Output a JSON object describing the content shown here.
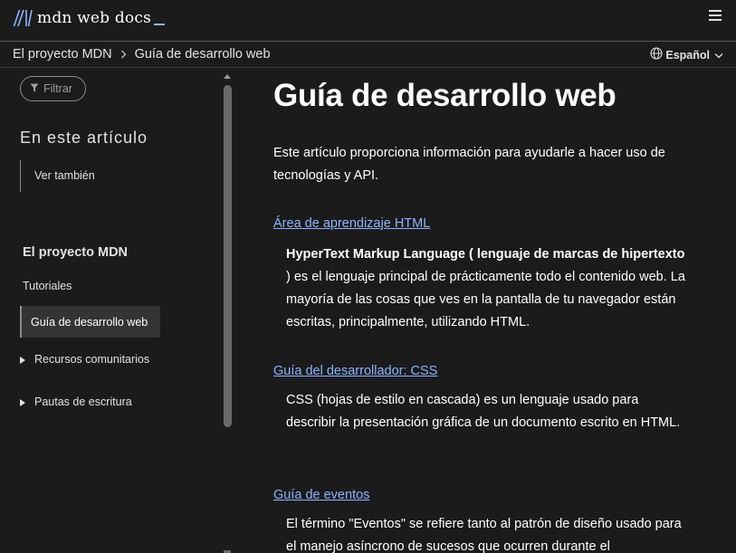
{
  "header": {
    "logo_text": "mdn web docs",
    "logo_icon": "mdn-m-icon",
    "menu_icon": "hamburger-menu-icon"
  },
  "breadcrumb": {
    "items": [
      "El proyecto MDN",
      "Guía de desarrollo web"
    ],
    "separator_icon": "chevron-right-icon"
  },
  "language": {
    "label": "Español",
    "icon": "globe-icon",
    "chevron": "chevron-down-icon"
  },
  "sidebar": {
    "filter_placeholder": "Filtrar",
    "filter_icon": "filter-icon",
    "toc_title": "En este artículo",
    "toc_items": [
      "Ver también"
    ],
    "nav_title": "El proyecto MDN",
    "nav_items": {
      "tutorials": "Tutoriales",
      "active": "Guía de desarrollo web",
      "community": "Recursos comunitarios",
      "writing": "Pautas de escritura"
    }
  },
  "main": {
    "title": "Guía de desarrollo web",
    "intro": "Este artículo proporciona información para ayudarle a hacer uso de tecnologías y API.",
    "sections": [
      {
        "link": "Área de aprendizaje HTML",
        "desc_bold": "HyperText Markup Language ( lenguaje de marcas de hipertexto",
        "desc_rest": " ) es el lenguaje principal de prácticamente todo el contenido web. La mayoría de las cosas que ves en la pantalla de tu navegador están escritas, principalmente, utilizando HTML."
      },
      {
        "link": "Guía del desarrollador: CSS",
        "desc": "CSS (hojas de estilo en cascada) es un lenguaje usado para describir la presentación gráfica de un documento escrito en HTML."
      },
      {
        "link": "Guía de eventos",
        "desc": "El término \"Eventos\" se refiere tanto al patrón de diseño usado para el manejo asíncrono de sucesos que ocurren durante el"
      }
    ]
  },
  "colors": {
    "background": "#1b1b1b",
    "link": "#8cb4ff",
    "active_item_bg": "#343434",
    "text": "#ffffff",
    "muted": "#9e9e9e"
  }
}
